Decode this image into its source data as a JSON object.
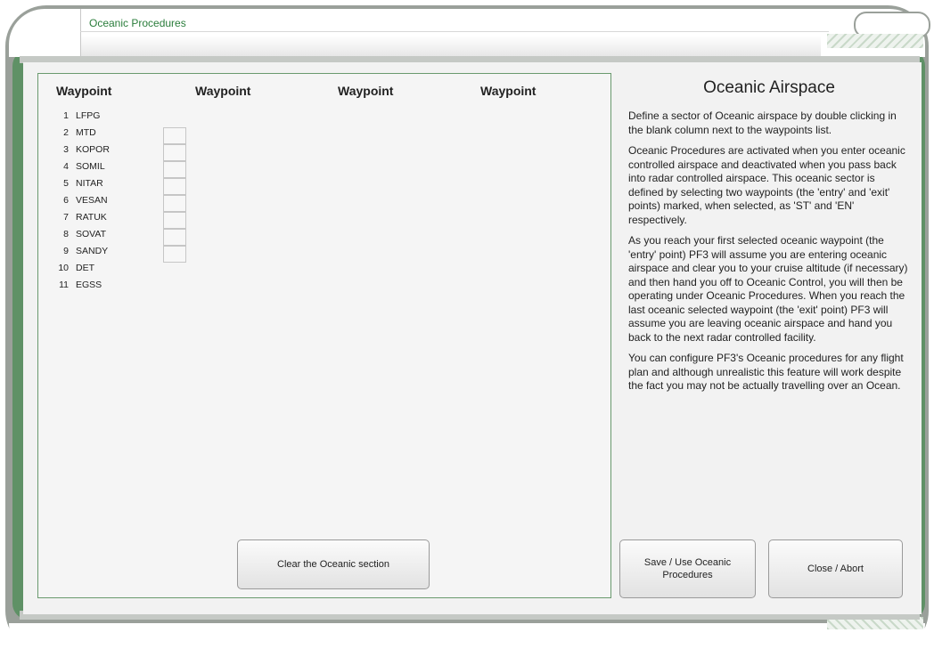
{
  "window": {
    "title": "Oceanic Procedures"
  },
  "waypoints": {
    "headers": [
      "Waypoint",
      "Waypoint",
      "Waypoint",
      "Waypoint"
    ],
    "rows": [
      {
        "num": "1",
        "name": "LFPG",
        "cell": false
      },
      {
        "num": "2",
        "name": "MTD",
        "cell": true
      },
      {
        "num": "3",
        "name": "KOPOR",
        "cell": true
      },
      {
        "num": "4",
        "name": "SOMIL",
        "cell": true
      },
      {
        "num": "5",
        "name": "NITAR",
        "cell": true
      },
      {
        "num": "6",
        "name": "VESAN",
        "cell": true
      },
      {
        "num": "7",
        "name": "RATUK",
        "cell": true
      },
      {
        "num": "8",
        "name": "SOVAT",
        "cell": true
      },
      {
        "num": "9",
        "name": "SANDY",
        "cell": true
      },
      {
        "num": "10",
        "name": "DET",
        "cell": false
      },
      {
        "num": "11",
        "name": "EGSS",
        "cell": false
      }
    ],
    "clear_button": "Clear the Oceanic section"
  },
  "info": {
    "title": "Oceanic Airspace",
    "paragraphs": [
      "Define a sector of Oceanic airspace by double clicking in the blank column next to the waypoints list.",
      "Oceanic Procedures are activated when you enter oceanic controlled airspace and deactivated when you pass back into radar controlled airspace. This oceanic sector is defined by selecting two waypoints (the 'entry' and 'exit' points) marked, when selected, as 'ST' and 'EN' respectively.",
      "As you reach your first selected oceanic waypoint (the 'entry' point) PF3 will assume you are entering oceanic airspace and clear you to your cruise altitude (if necessary) and then hand you off to Oceanic Control, you will then be operating under Oceanic Procedures. When you reach the last oceanic selected waypoint (the 'exit' point) PF3 will assume you are leaving oceanic airspace and hand you back to the next radar controlled facility.",
      "You can configure PF3's Oceanic procedures for any flight plan and although unrealistic this feature will work despite the fact you may not be actually travelling over an Ocean."
    ]
  },
  "buttons": {
    "save": "Save / Use Oceanic Procedures",
    "close": "Close / Abort"
  }
}
